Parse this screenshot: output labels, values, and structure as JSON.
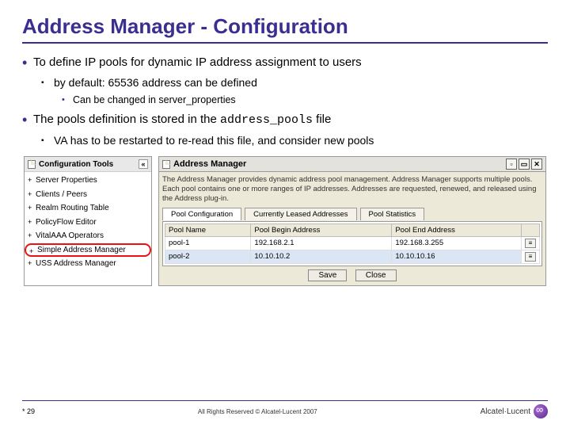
{
  "title": "Address Manager - Configuration",
  "bullets": {
    "b1": "To define IP pools for dynamic IP address assignment to users",
    "b1_1": "by default: 65536 address can be defined",
    "b1_1_1": "Can be changed in server_properties",
    "b2_pre": "The pools definition is stored in the ",
    "b2_code": "address_pools",
    "b2_post": " file",
    "b2_1": "VA has to be restarted to re-read this file, and consider new pools"
  },
  "sidebar": {
    "header": "Configuration Tools",
    "items": [
      "Server Properties",
      "Clients / Peers",
      "Realm Routing Table",
      "PolicyFlow Editor",
      "VitalAAA Operators",
      "Simple Address Manager",
      "USS Address Manager"
    ]
  },
  "panel": {
    "title": "Address Manager",
    "desc": "The Address Manager provides dynamic address pool management. Address Manager supports multiple pools. Each pool contains one or more ranges of IP addresses. Addresses are requested, renewed, and released using the Address plug-in.",
    "tabs": [
      "Pool Configuration",
      "Currently Leased Addresses",
      "Pool Statistics"
    ],
    "columns": [
      "Pool Name",
      "Pool Begin Address",
      "Pool End Address"
    ],
    "rows": [
      {
        "name": "pool-1",
        "begin": "192.168.2.1",
        "end": "192.168.3.255"
      },
      {
        "name": "pool-2",
        "begin": "10.10.10.2",
        "end": "10.10.10.16"
      }
    ],
    "save": "Save",
    "close": "Close"
  },
  "footer": {
    "page": "29",
    "copyright": "All Rights Reserved © Alcatel-Lucent 2007",
    "brand": "Alcatel·Lucent"
  }
}
